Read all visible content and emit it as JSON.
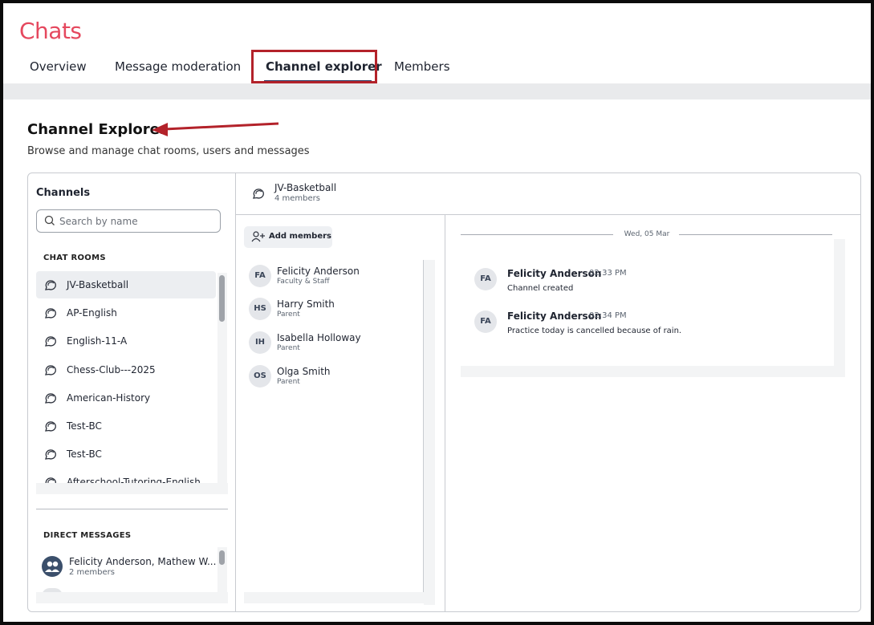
{
  "app": {
    "title": "Chats"
  },
  "tabs": [
    {
      "label": "Overview"
    },
    {
      "label": "Message moderation"
    },
    {
      "label": "Channel explorer",
      "active": true
    },
    {
      "label": "Members"
    }
  ],
  "page": {
    "title": "Channel Explorer",
    "subtitle": "Browse and manage chat rooms, users and messages"
  },
  "channels": {
    "title": "Channels",
    "search_placeholder": "Search by name",
    "chat_rooms_label": "CHAT ROOMS",
    "rooms": [
      {
        "label": "JV-Basketball",
        "active": true
      },
      {
        "label": "AP-English"
      },
      {
        "label": "English-11-A"
      },
      {
        "label": "Chess-Club---2025"
      },
      {
        "label": "American-History"
      },
      {
        "label": "Test-BC"
      },
      {
        "label": "Test-BC"
      },
      {
        "label": "Afterschool-Tutoring-English"
      }
    ],
    "direct_messages_label": "DIRECT MESSAGES",
    "direct_messages": [
      {
        "name": "Felicity Anderson, Mathew W...",
        "sub": "2 members"
      }
    ]
  },
  "channel": {
    "name": "JV-Basketball",
    "members_count": "4 members",
    "add_members_label": "Add members",
    "members": [
      {
        "initials": "FA",
        "name": "Felicity Anderson",
        "role": "Faculty & Staff"
      },
      {
        "initials": "HS",
        "name": "Harry Smith",
        "role": "Parent"
      },
      {
        "initials": "IH",
        "name": "Isabella Holloway",
        "role": "Parent"
      },
      {
        "initials": "OS",
        "name": "Olga Smith",
        "role": "Parent"
      }
    ]
  },
  "messages": {
    "date": "Wed, 05 Mar",
    "items": [
      {
        "initials": "FA",
        "author": "Felicity Anderson",
        "time": "02:33 PM",
        "text": "Channel created"
      },
      {
        "initials": "FA",
        "author": "Felicity Anderson",
        "time": "02:34 PM",
        "text": "Practice today is cancelled because of rain."
      }
    ]
  },
  "colors": {
    "brand": "#e5485e",
    "highlight_box": "#b3222a",
    "active_tab_underline": "#2d3a64"
  },
  "icons": [
    "search-icon",
    "chat-room-icon",
    "add-user-icon",
    "group-avatar-icon",
    "annotation-arrow"
  ]
}
